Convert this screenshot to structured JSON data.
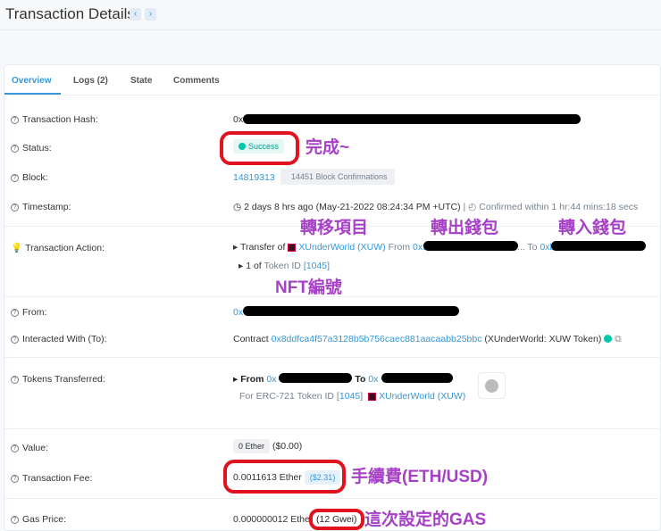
{
  "header": {
    "title": "Transaction Details",
    "prev": "‹",
    "next": "›"
  },
  "tabs": [
    "Overview",
    "Logs (2)",
    "State",
    "Comments"
  ],
  "rows": {
    "hash": {
      "label": "Transaction Hash:",
      "value": "0x"
    },
    "status": {
      "label": "Status:",
      "value": "Success"
    },
    "block": {
      "label": "Block:",
      "value": "14819313",
      "confirmations": "14451 Block Confirmations"
    },
    "timestamp": {
      "label": "Timestamp:",
      "value": "2 days 8 hrs ago (May-21-2022 08:24:34 PM +UTC)",
      "sep": "|",
      "confirmed": "Confirmed within 1 hr:44 mins:18 secs"
    },
    "action": {
      "label": "Transaction Action:",
      "transfer_of": "Transfer of",
      "token": "XUnderWorld (XUW)",
      "from": "From",
      "from_addr": "0x9",
      "to": "To",
      "to_addr": "0xb",
      "ellipsis": "...",
      "qty": "1 of",
      "token_id_label": "Token ID",
      "token_id": "[1045]"
    },
    "from": {
      "label": "From:",
      "value": "0x"
    },
    "interacted": {
      "label": "Interacted With (To):",
      "prefix": "Contract",
      "address": "0x8ddfca4f57a3128b5b756caec881aacaabb25bbc",
      "name": "(XUnderWorld: XUW Token)"
    },
    "tokens": {
      "label": "Tokens Transferred:",
      "from": "From",
      "from_addr": "0x",
      "to": "To",
      "to_addr": "0x",
      "for": "For ERC-721 Token ID",
      "id": "1045",
      "token": "XUnderWorld (XUW)"
    },
    "value": {
      "label": "Value:",
      "ether": "0 Ether",
      "usd": "($0.00)"
    },
    "fee": {
      "label": "Transaction Fee:",
      "ether": "0.0011613 Ether",
      "usd": "($2.31)"
    },
    "gas": {
      "label": "Gas Price:",
      "ether": "0.000000012 Ether",
      "gwei": "(12 Gwei)"
    }
  },
  "annotations": {
    "status": "完成~",
    "item": "轉移項目",
    "out": "轉出錢包",
    "in": "轉入錢包",
    "nft": "NFT編號",
    "fee": "手續費(ETH/USD)",
    "gas": "這次設定的GAS"
  },
  "colors": {
    "accent": "#3498db",
    "success": "#00c9a7",
    "annotation": "#a640c6",
    "ring": "#e0131e"
  }
}
